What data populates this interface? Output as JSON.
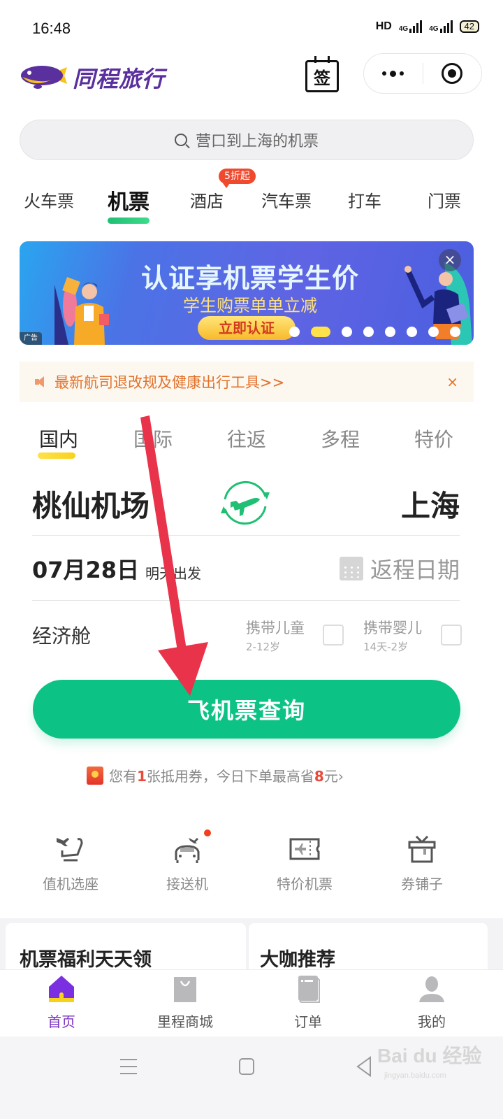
{
  "status_bar": {
    "time": "16:48",
    "network_label": "HD",
    "signal1_label": "4G",
    "signal2_label": "4G",
    "battery": "42"
  },
  "header": {
    "brand_name": "同程旅行",
    "sign_in_label": "签",
    "capsule_more": "more-icon",
    "capsule_close": "target-icon"
  },
  "search": {
    "placeholder": "营口到上海的机票"
  },
  "category_tabs": [
    {
      "label": "火车票",
      "active": false
    },
    {
      "label": "机票",
      "active": true
    },
    {
      "label": "酒店",
      "active": false,
      "badge": "5折起"
    },
    {
      "label": "汽车票",
      "active": false
    },
    {
      "label": "打车",
      "active": false
    },
    {
      "label": "门票",
      "active": false
    }
  ],
  "banner": {
    "title": "认证享机票学生价",
    "subtitle": "学生购票单单立减",
    "cta": "立即认证",
    "ad_label": "广告",
    "close_label": "×",
    "dots_total": 8,
    "active_dot": 2
  },
  "notice": {
    "text": "最新航司退改规及健康出行工具>>",
    "close_label": "×"
  },
  "flight_tabs": [
    {
      "label": "国内",
      "active": true
    },
    {
      "label": "国际",
      "active": false
    },
    {
      "label": "往返",
      "active": false
    },
    {
      "label": "多程",
      "active": false
    },
    {
      "label": "特价",
      "active": false
    }
  ],
  "route": {
    "from": "桃仙机场",
    "to": "上海"
  },
  "date": {
    "departure": "07月28日",
    "departure_note": "明天出发",
    "return_placeholder": "返程日期"
  },
  "options": {
    "cabin": "经济舱",
    "child_label": "携带儿童",
    "child_age": "2-12岁",
    "child_checked": false,
    "infant_label": "携带婴儿",
    "infant_age": "14天-2岁",
    "infant_checked": false
  },
  "search_button": "飞机票查询",
  "coupon": {
    "prefix": "您有",
    "count": "1",
    "middle": "张抵用券，今日下单最高省",
    "amount": "8",
    "suffix": "元",
    "chevron": "›"
  },
  "quick_links": [
    {
      "label": "值机选座",
      "icon": "seat-icon"
    },
    {
      "label": "接送机",
      "icon": "car-plane-icon",
      "has_dot": true
    },
    {
      "label": "特价机票",
      "icon": "ticket-icon"
    },
    {
      "label": "券铺子",
      "icon": "gift-icon"
    }
  ],
  "cards": [
    {
      "title": "机票福利天天领"
    },
    {
      "title": "大咖推荐"
    }
  ],
  "bottom_nav": [
    {
      "label": "首页",
      "icon": "home-icon",
      "active": true
    },
    {
      "label": "里程商城",
      "icon": "bag-icon",
      "active": false
    },
    {
      "label": "订单",
      "icon": "order-icon",
      "active": false
    },
    {
      "label": "我的",
      "icon": "user-icon",
      "active": false
    }
  ],
  "watermark": {
    "brand": "Bai du 经验",
    "url": "jingyan.baidu.com"
  },
  "colors": {
    "brand_purple": "#5a2f9e",
    "primary_green": "#0cc285",
    "accent_yellow": "#ffe14a",
    "notice_orange": "#e2712b",
    "highlight_red": "#e84a3b",
    "annotation_red": "#e8334a"
  }
}
